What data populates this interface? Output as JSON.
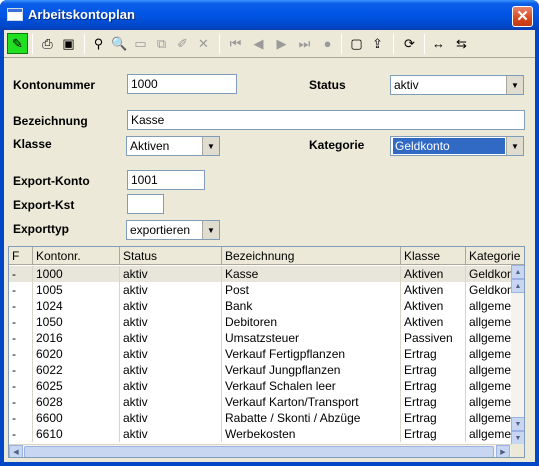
{
  "window": {
    "title": "Arbeitskontoplan",
    "close_symbol": "✕"
  },
  "toolbar": {
    "buttons": [
      {
        "name": "edit-pencil-icon",
        "glyph": "✎"
      },
      {
        "name": "print-icon",
        "glyph": "⎙"
      },
      {
        "name": "save-icon",
        "glyph": "▣"
      },
      {
        "name": "find-binoculars-icon",
        "glyph": "⚲"
      },
      {
        "name": "search-key-icon",
        "glyph": "🔍"
      },
      {
        "name": "new-document-icon",
        "glyph": "▭"
      },
      {
        "name": "copy-document-icon",
        "glyph": "⧉"
      },
      {
        "name": "brush-icon",
        "glyph": "✐"
      },
      {
        "name": "delete-icon",
        "glyph": "✕"
      },
      {
        "name": "first-record-icon",
        "glyph": "⏮"
      },
      {
        "name": "previous-record-icon",
        "glyph": "◀"
      },
      {
        "name": "next-record-icon",
        "glyph": "▶"
      },
      {
        "name": "last-record-icon",
        "glyph": "⏭"
      },
      {
        "name": "reload-icon",
        "glyph": "●"
      },
      {
        "name": "window-icon",
        "glyph": "▢"
      },
      {
        "name": "export-icon",
        "glyph": "⇪"
      },
      {
        "name": "refresh-icon",
        "glyph": "⟳"
      },
      {
        "name": "expand-columns-icon",
        "glyph": "↔"
      },
      {
        "name": "fit-columns-icon",
        "glyph": "⇆"
      }
    ]
  },
  "form": {
    "kontonummer_label": "Kontonummer",
    "kontonummer_value": "1000",
    "status_label": "Status",
    "status_value": "aktiv",
    "bezeichnung_label": "Bezeichnung",
    "bezeichnung_value": "Kasse",
    "klasse_label": "Klasse",
    "klasse_value": "Aktiven",
    "kategorie_label": "Kategorie",
    "kategorie_value": "Geldkonto",
    "export_konto_label": "Export-Konto",
    "export_konto_value": "1001",
    "export_kst_label": "Export-Kst",
    "export_kst_value": "",
    "exporttyp_label": "Exporttyp",
    "exporttyp_value": "exportieren"
  },
  "grid": {
    "columns": [
      "F",
      "Kontonr.",
      "Status",
      "Bezeichnung",
      "Klasse",
      "Kategorie"
    ],
    "rows": [
      {
        "f": "-",
        "nr": "1000",
        "status": "aktiv",
        "bez": "Kasse",
        "klasse": "Aktiven",
        "kat": "Geldkonto"
      },
      {
        "f": "-",
        "nr": "1005",
        "status": "aktiv",
        "bez": "Post",
        "klasse": "Aktiven",
        "kat": "Geldkonto"
      },
      {
        "f": "-",
        "nr": "1024",
        "status": "aktiv",
        "bez": "Bank",
        "klasse": "Aktiven",
        "kat": "allgemein"
      },
      {
        "f": "-",
        "nr": "1050",
        "status": "aktiv",
        "bez": "Debitoren",
        "klasse": "Aktiven",
        "kat": "allgemein"
      },
      {
        "f": "-",
        "nr": "2016",
        "status": "aktiv",
        "bez": "Umsatzsteuer",
        "klasse": "Passiven",
        "kat": "allgemein"
      },
      {
        "f": "-",
        "nr": "6020",
        "status": "aktiv",
        "bez": "Verkauf Fertigpflanzen",
        "klasse": "Ertrag",
        "kat": "allgemein"
      },
      {
        "f": "-",
        "nr": "6022",
        "status": "aktiv",
        "bez": "Verkauf Jungpflanzen",
        "klasse": "Ertrag",
        "kat": "allgemein"
      },
      {
        "f": "-",
        "nr": "6025",
        "status": "aktiv",
        "bez": "Verkauf Schalen leer",
        "klasse": "Ertrag",
        "kat": "allgemein"
      },
      {
        "f": "-",
        "nr": "6028",
        "status": "aktiv",
        "bez": "Verkauf Karton/Transport",
        "klasse": "Ertrag",
        "kat": "allgemein"
      },
      {
        "f": "-",
        "nr": "6600",
        "status": "aktiv",
        "bez": "Rabatte / Skonti / Abzüge",
        "klasse": "Ertrag",
        "kat": "allgemein"
      },
      {
        "f": "-",
        "nr": "6610",
        "status": "aktiv",
        "bez": "Werbekosten",
        "klasse": "Ertrag",
        "kat": "allgemein"
      }
    ]
  },
  "colors": {
    "title_bar": "#0055e5",
    "active_tool": "#21e021",
    "selection": "#316ac5"
  }
}
